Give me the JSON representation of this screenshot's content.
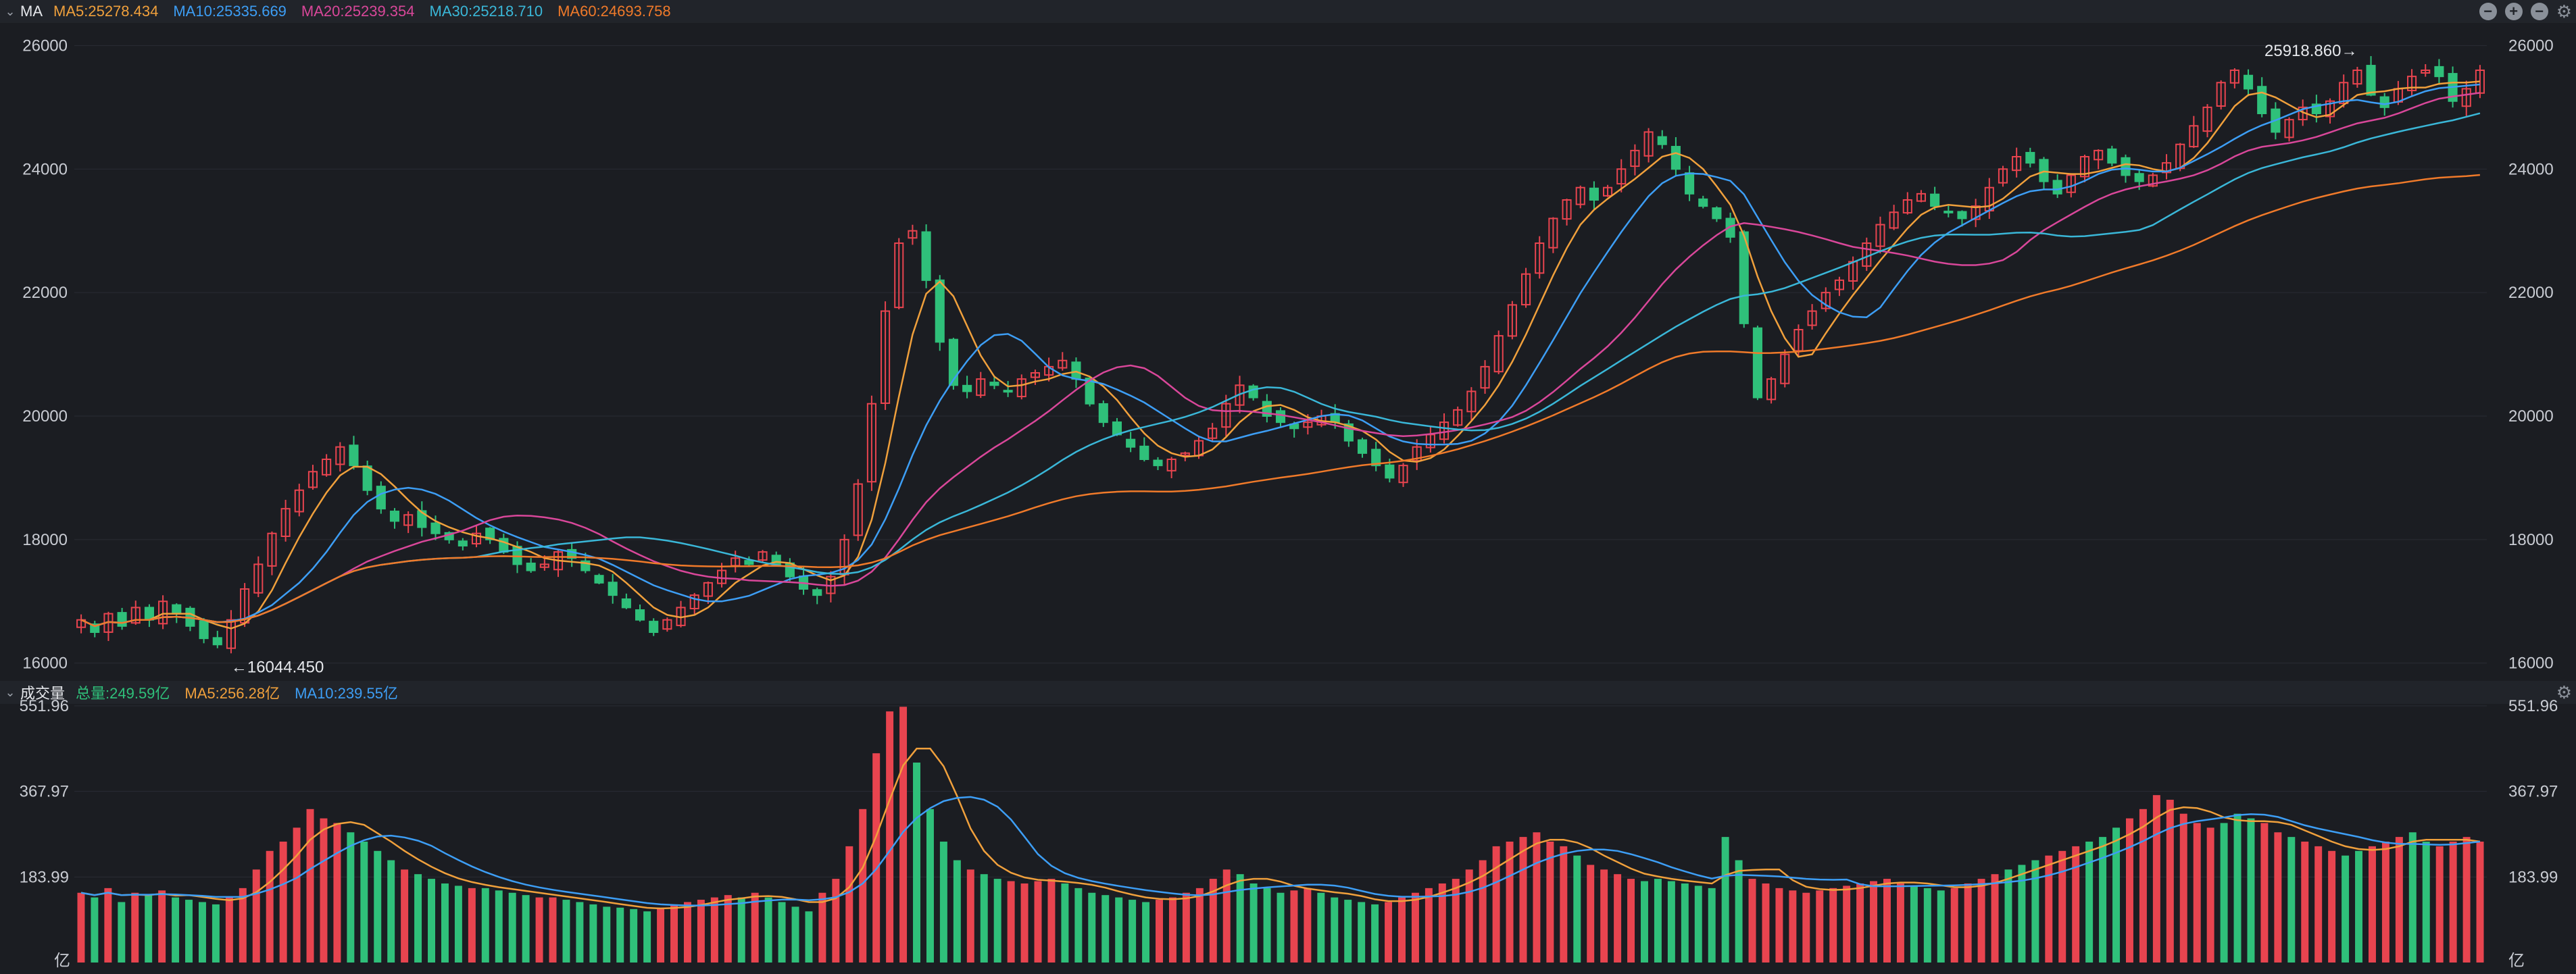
{
  "price_panel": {
    "label": "MA",
    "ma_legend": [
      {
        "text": "MA5:25278.434",
        "color": "#f0a03c"
      },
      {
        "text": "MA10:25335.669",
        "color": "#3d9ef5"
      },
      {
        "text": "MA20:25239.354",
        "color": "#d9479a"
      },
      {
        "text": "MA30:25218.710",
        "color": "#3ab7d8"
      },
      {
        "text": "MA60:24693.758",
        "color": "#f07a2a"
      }
    ],
    "high_annotation": "25918.860→",
    "low_annotation": "←16044.450"
  },
  "volume_panel": {
    "label": "成交量",
    "legend": [
      {
        "text": "总量:249.59亿",
        "color": "#2fc07a"
      },
      {
        "text": "MA5:256.28亿",
        "color": "#f0a03c"
      },
      {
        "text": "MA10:239.55亿",
        "color": "#3d9ef5"
      }
    ],
    "unit": "亿"
  },
  "colors": {
    "up": "#e8444f",
    "down": "#2fc07a",
    "background": "#1b1d22",
    "grid": "#2a2d34",
    "axis_text": "#c9ccd3"
  },
  "chart_data": [
    {
      "type": "candlestick",
      "y_ticks": [
        "26000",
        "24000",
        "22000",
        "20000",
        "18000",
        "16000"
      ],
      "ylim": [
        15800,
        26300
      ],
      "series_close": [
        16700,
        16500,
        16800,
        16600,
        16900,
        16700,
        17000,
        16800,
        16600,
        16400,
        16300,
        16700,
        17200,
        17600,
        18100,
        18500,
        18800,
        19100,
        19300,
        19500,
        19200,
        18800,
        18500,
        18300,
        18400,
        18200,
        18100,
        18000,
        17900,
        18100,
        18000,
        17800,
        17600,
        17500,
        17600,
        17800,
        17700,
        17500,
        17300,
        17100,
        16900,
        16700,
        16500,
        16700,
        16900,
        17100,
        17300,
        17500,
        17700,
        17600,
        17800,
        17600,
        17400,
        17200,
        17100,
        17400,
        18000,
        18900,
        20200,
        21700,
        22800,
        23000,
        22200,
        21200,
        20500,
        20400,
        20600,
        20500,
        20400,
        20600,
        20700,
        20800,
        20900,
        20600,
        20200,
        19900,
        19700,
        19500,
        19300,
        19200,
        19300,
        19400,
        19600,
        19800,
        20200,
        20500,
        20300,
        20000,
        19900,
        19800,
        19900,
        20000,
        19900,
        19600,
        19400,
        19200,
        19000,
        19200,
        19500,
        19700,
        19900,
        20100,
        20400,
        20800,
        21300,
        21800,
        22300,
        22800,
        23200,
        23500,
        23700,
        23500,
        23700,
        24000,
        24300,
        24600,
        24400,
        24000,
        23600,
        23400,
        23200,
        22900,
        21500,
        20300,
        20600,
        21000,
        21400,
        21700,
        22000,
        22200,
        22500,
        22800,
        23100,
        23300,
        23500,
        23600,
        23400,
        23300,
        23200,
        23400,
        23700,
        24000,
        24200,
        24100,
        23800,
        23600,
        23900,
        24200,
        24300,
        24100,
        23900,
        23800,
        23900,
        24100,
        24400,
        24700,
        25000,
        25400,
        25600,
        25300,
        24900,
        24600,
        24800,
        25000,
        24900,
        25100,
        25400,
        25600,
        25200,
        25000,
        25300,
        25500,
        25600,
        25500,
        25100,
        25300,
        25600
      ],
      "high_annotation_value": 25918.86,
      "low_annotation_value": 16044.45
    },
    {
      "type": "bar",
      "y_ticks": [
        "551.96",
        "367.97",
        "183.99"
      ],
      "ylim": [
        0,
        551.96
      ],
      "values": [
        150,
        140,
        160,
        130,
        150,
        145,
        155,
        140,
        135,
        130,
        125,
        140,
        160,
        200,
        240,
        260,
        290,
        330,
        310,
        300,
        280,
        260,
        240,
        220,
        200,
        190,
        180,
        170,
        165,
        160,
        160,
        155,
        150,
        145,
        140,
        140,
        135,
        130,
        125,
        120,
        118,
        115,
        110,
        118,
        125,
        130,
        135,
        140,
        145,
        140,
        150,
        140,
        130,
        120,
        110,
        150,
        180,
        250,
        330,
        450,
        540,
        550,
        430,
        330,
        260,
        220,
        200,
        190,
        180,
        175,
        170,
        175,
        180,
        170,
        160,
        150,
        145,
        140,
        135,
        130,
        135,
        140,
        150,
        160,
        180,
        200,
        190,
        170,
        160,
        150,
        155,
        160,
        150,
        140,
        135,
        130,
        125,
        130,
        140,
        150,
        160,
        170,
        180,
        200,
        220,
        250,
        260,
        270,
        280,
        260,
        250,
        230,
        210,
        200,
        190,
        180,
        175,
        180,
        175,
        170,
        165,
        160,
        270,
        220,
        180,
        170,
        160,
        155,
        150,
        155,
        160,
        165,
        170,
        175,
        180,
        170,
        165,
        160,
        155,
        160,
        170,
        180,
        190,
        200,
        210,
        220,
        230,
        240,
        250,
        260,
        270,
        290,
        310,
        330,
        360,
        350,
        320,
        300,
        290,
        300,
        320,
        310,
        300,
        280,
        270,
        260,
        250,
        240,
        230,
        240,
        250,
        260,
        270,
        280,
        260,
        250,
        260,
        270,
        260
      ],
      "series": [
        {
          "name": "MA5"
        },
        {
          "name": "MA10"
        }
      ]
    }
  ]
}
